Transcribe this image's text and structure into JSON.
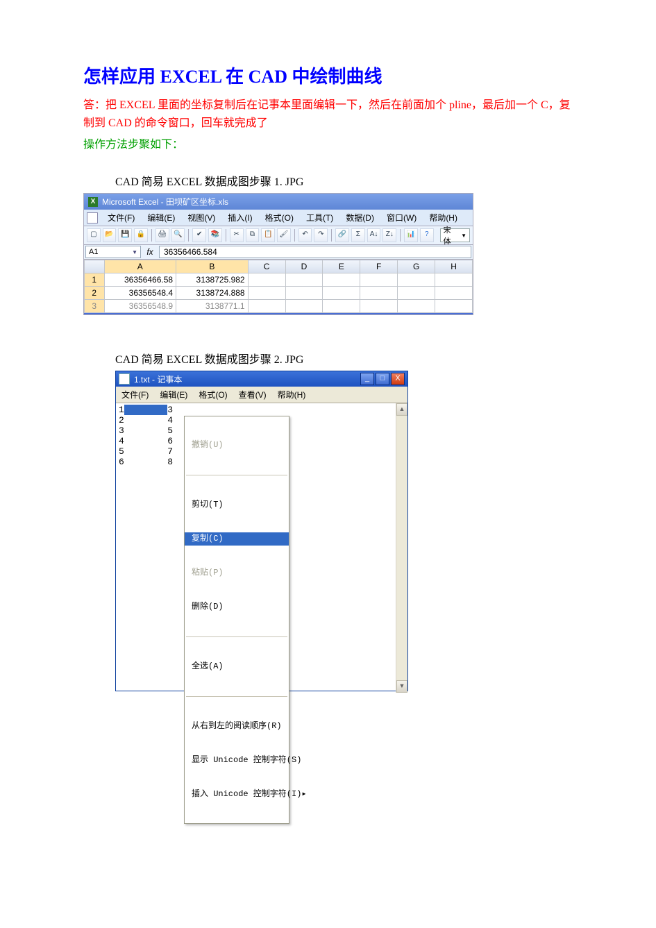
{
  "doc": {
    "title": "怎样应用 EXCEL  在 CAD 中绘制曲线",
    "answer": "答：把 EXCEL 里面的坐标复制后在记事本里面编辑一下，然后在前面加个 pline，最后加一个 C，复制到 CAD 的命令窗口，回车就完成了",
    "steps_label": "操作方法步聚如下：",
    "caption1": "CAD 简易 EXCEL 数据成图步骤 1. JPG",
    "caption2": "CAD 简易 EXCEL 数据成图步骤 2. JPG"
  },
  "excel": {
    "title": "Microsoft Excel - 田坝矿区坐标.xls",
    "menus": [
      "文件(F)",
      "编辑(E)",
      "视图(V)",
      "插入(I)",
      "格式(O)",
      "工具(T)",
      "数据(D)",
      "窗口(W)",
      "帮助(H)"
    ],
    "toolbar_icons": [
      "new",
      "open",
      "save",
      "perm",
      "print",
      "preview",
      "spell",
      "research",
      "cut",
      "copy",
      "paste",
      "format-painter",
      "undo",
      "redo",
      "link",
      "autosum",
      "sort-asc",
      "sort-desc",
      "chart",
      "help"
    ],
    "font_name": "宋体",
    "namebox": "A1",
    "fx_label": "fx",
    "formula_value": "36356466.584",
    "columns": [
      "A",
      "B",
      "C",
      "D",
      "E",
      "F",
      "G",
      "H"
    ],
    "rows": [
      {
        "n": "1",
        "a": "36356466.58",
        "b": "3138725.982"
      },
      {
        "n": "2",
        "a": "36356548.4",
        "b": "3138724.888"
      },
      {
        "n": "3",
        "a": "36356548.9",
        "b": "3138771.1"
      }
    ]
  },
  "notepad": {
    "title": "1.txt - 记事本",
    "menus": [
      "文件(F)",
      "编辑(E)",
      "格式(O)",
      "查看(V)",
      "帮助(H)"
    ],
    "lines_left": [
      "1",
      "2",
      "3",
      "4",
      "5",
      "6"
    ],
    "lines_right": [
      "3",
      "4",
      "5",
      "6",
      "7",
      "8"
    ],
    "context": {
      "undo": "撤销(U)",
      "cut": "剪切(T)",
      "copy": "复制(C)",
      "paste": "粘贴(P)",
      "delete": "删除(D)",
      "select_all": "全选(A)",
      "rtl": "从右到左的阅读顺序(R)",
      "show_unicode": "显示 Unicode 控制字符(S)",
      "insert_unicode": "插入 Unicode 控制字符(I)"
    },
    "controls": {
      "min": "_",
      "max": "□",
      "close": "X"
    }
  }
}
